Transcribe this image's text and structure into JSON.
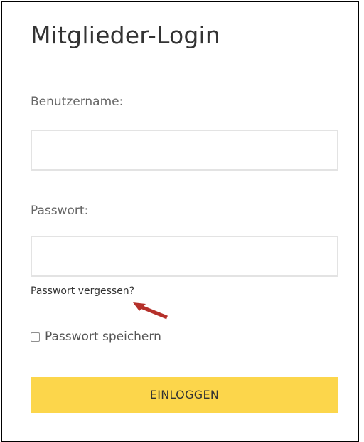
{
  "login": {
    "title": "Mitglieder-Login",
    "username_label": "Benutzername:",
    "username_value": "",
    "password_label": "Passwort:",
    "password_value": "",
    "forgot_link": "Passwort vergessen?",
    "remember_label": "Passwort speichern",
    "remember_checked": false,
    "submit_label": "EINLOGGEN"
  },
  "colors": {
    "button_background": "#fcd64b",
    "annotation_arrow": "#b5302a"
  },
  "icons": {
    "annotation": "arrow-annotation-icon"
  }
}
